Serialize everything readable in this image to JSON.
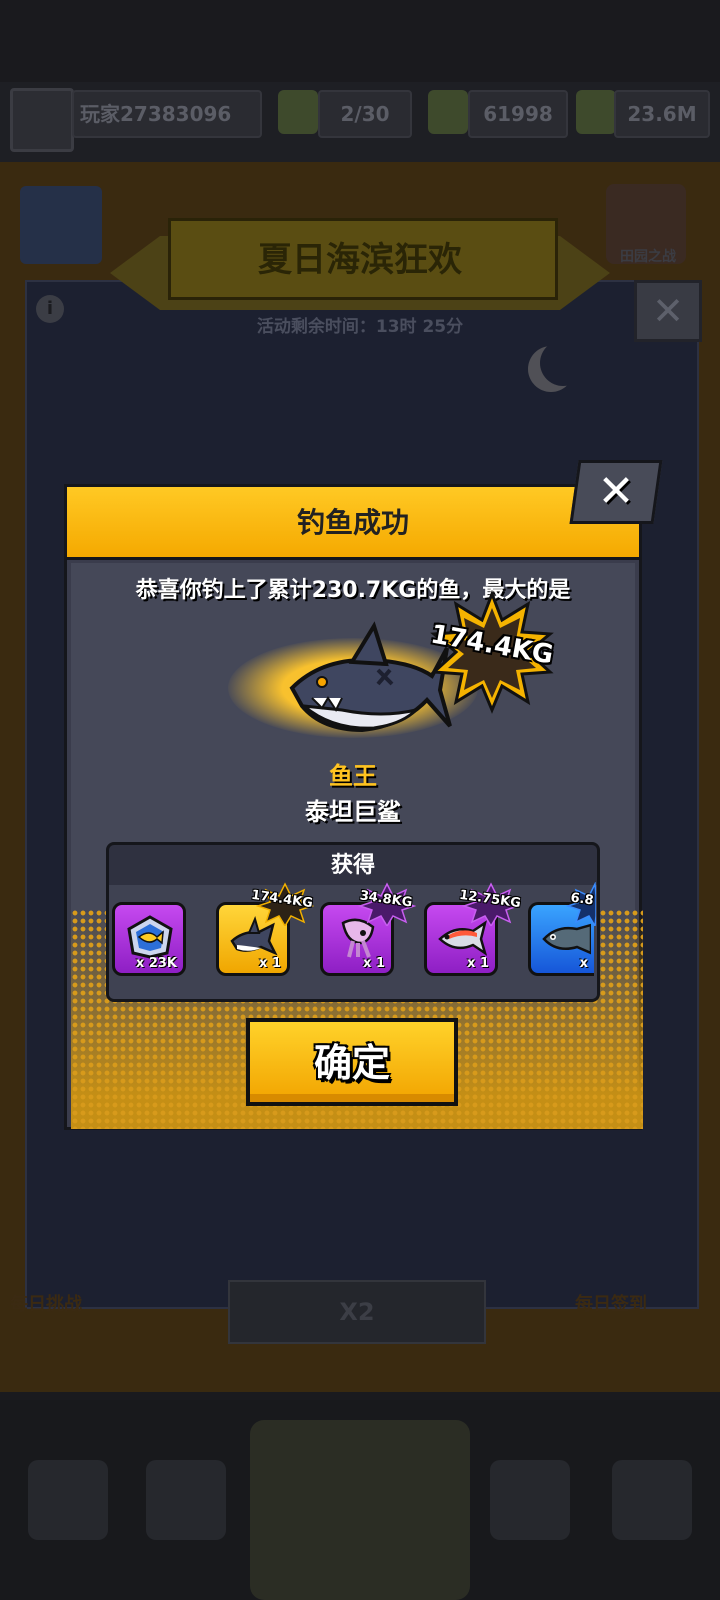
{
  "background": {
    "player_name": "玩家27383096",
    "energy": "2/30",
    "currency": "61998",
    "coins": "23.6M",
    "event_title": "夏日海滨狂欢",
    "event_timer": "活动剩余时间：13时 25分",
    "shield_label": "田园之战",
    "bottom_left_label": "每日挑战",
    "bottom_center_label": "X2",
    "bottom_right_label": "每日签到"
  },
  "dialog": {
    "title": "钓鱼成功",
    "close_icon": "close-x-icon",
    "message": "恭喜你钓上了累计230.7KG的鱼，最大的是",
    "biggest_weight": "174.4KG",
    "fish_rank": "鱼王",
    "fish_name": "泰坦巨鲨",
    "rewards_title": "获得",
    "rewards": [
      {
        "icon": "fish-token-icon",
        "count": "x 23K",
        "tag": "",
        "rarity": "purple"
      },
      {
        "icon": "shark-icon",
        "count": "x 1",
        "tag": "174.4KG",
        "rarity": "gold"
      },
      {
        "icon": "squid-icon",
        "count": "x 1",
        "tag": "34.8KG",
        "rarity": "purple"
      },
      {
        "icon": "salmon-icon",
        "count": "x 1",
        "tag": "12.75KG",
        "rarity": "purple"
      },
      {
        "icon": "grouper-icon",
        "count": "x",
        "tag": "6.8",
        "rarity": "blue"
      }
    ],
    "confirm_label": "确定"
  },
  "colors": {
    "accent_gold": "#f5a900",
    "panel_gray": "#454858",
    "rarity_purple": "#b236e6",
    "rarity_gold": "#f7c21c",
    "rarity_blue": "#2a7ff0"
  }
}
